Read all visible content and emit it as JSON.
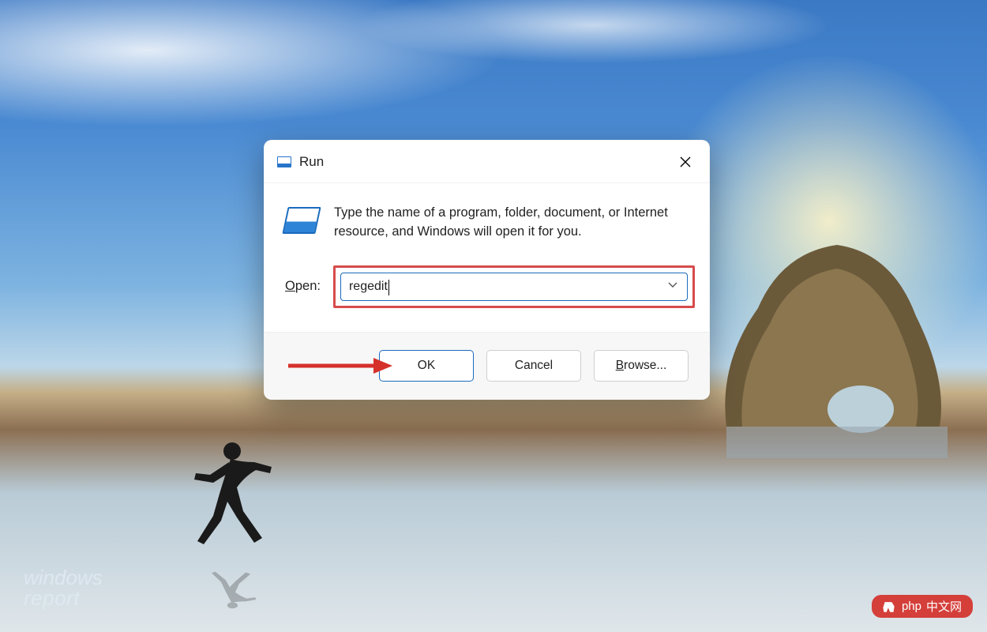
{
  "dialog": {
    "title": "Run",
    "description": "Type the name of a program, folder, document, or Internet resource, and Windows will open it for you.",
    "open_label_before": "O",
    "open_label_after": "pen:",
    "input_value": "regedit",
    "buttons": {
      "ok": "OK",
      "cancel": "Cancel",
      "browse_u": "B",
      "browse_rest": "rowse..."
    }
  },
  "watermark": {
    "line1": "windows",
    "line2": "report"
  },
  "badge": {
    "prefix": "php",
    "suffix": "中文网"
  },
  "colors": {
    "accent": "#1a6bbd",
    "highlight": "#d64b4b"
  }
}
